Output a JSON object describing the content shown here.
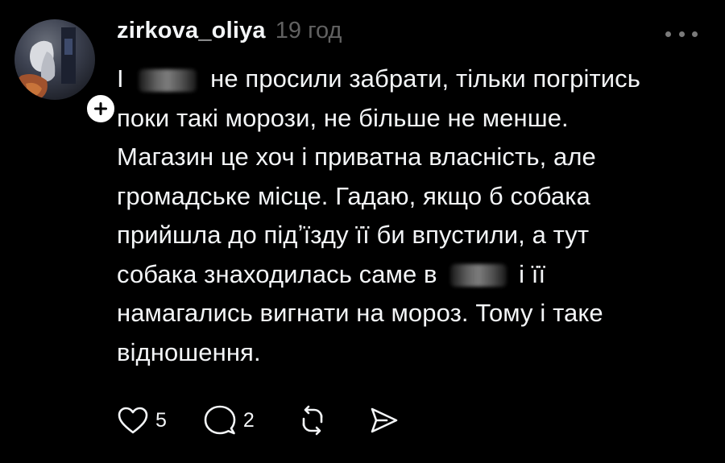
{
  "post": {
    "username": "zirkova_oliya",
    "time": "19 год",
    "lines": [
      {
        "before": "І",
        "after": "не просили забрати, тільки погрітись"
      },
      {
        "text": "поки такі морози, не більше не менше."
      },
      {
        "text": "Магазин це хоч і приватна власність, але"
      },
      {
        "text": "громадське місце. Гадаю, якщо б собака"
      },
      {
        "text": "прийшла до підʼїзду її би впустили, а тут"
      },
      {
        "before": "собака знаходилась саме в",
        "after": "і її"
      },
      {
        "text": "намагались вигнати на мороз. Тому і таке"
      },
      {
        "text": "відношення."
      }
    ]
  },
  "actions": {
    "likes": "5",
    "comments": "2"
  },
  "icons": {
    "follow": "plus-icon",
    "more": "more-dots-icon",
    "like": "heart-icon",
    "comment": "comment-bubble-icon",
    "repost": "repost-icon",
    "share": "send-icon"
  },
  "colors": {
    "background": "#000000",
    "text": "#f3f5f7",
    "muted": "#616161"
  }
}
